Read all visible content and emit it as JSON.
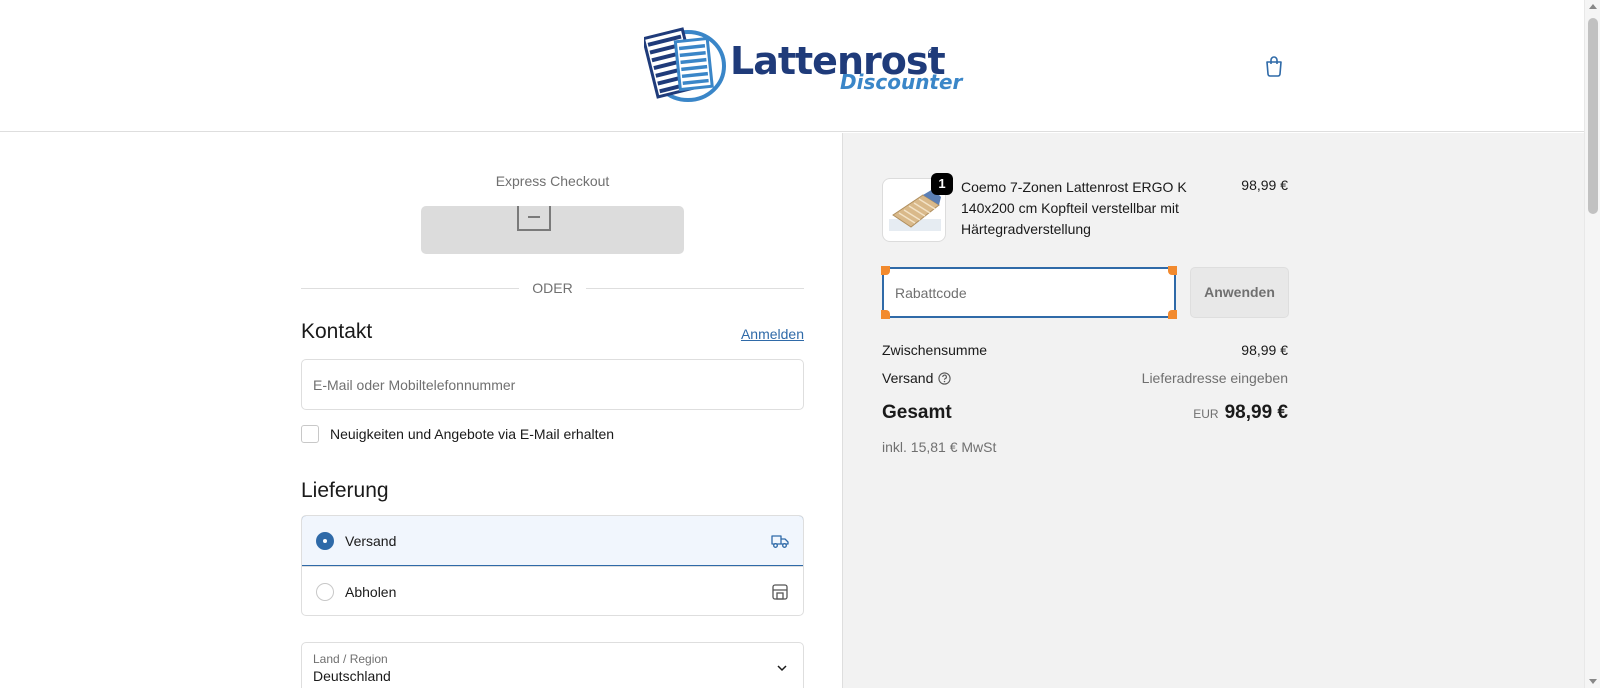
{
  "header": {
    "logo_text": "Lattenrost",
    "logo_sub": "Discounter",
    "logo_reg": "®"
  },
  "express": {
    "title": "Express Checkout",
    "divider": "ODER"
  },
  "contact": {
    "heading": "Kontakt",
    "login_link": "Anmelden",
    "email_placeholder": "E-Mail oder Mobiltelefonnummer",
    "newsletter_label": "Neuigkeiten und Angebote via E-Mail erhalten"
  },
  "delivery": {
    "heading": "Lieferung",
    "options": [
      {
        "label": "Versand",
        "selected": true,
        "icon": "truck-icon"
      },
      {
        "label": "Abholen",
        "selected": false,
        "icon": "store-icon"
      }
    ],
    "country": {
      "label": "Land / Region",
      "value": "Deutschland"
    }
  },
  "summary": {
    "item": {
      "name": "Coemo 7-Zonen Lattenrost ERGO K 140x200 cm Kopfteil verstellbar mit Härtegradverstellung",
      "price": "98,99 €",
      "quantity": "1"
    },
    "discount_placeholder": "Rabattcode",
    "apply_label": "Anwenden",
    "subtotal_label": "Zwischensumme",
    "subtotal_value": "98,99 €",
    "shipping_label": "Versand",
    "shipping_value": "Lieferadresse eingeben",
    "total_label": "Gesamt",
    "total_currency": "EUR",
    "total_value": "98,99 €",
    "tax_note": "inkl. 15,81 € MwSt"
  },
  "colors": {
    "accent": "#2f6aa8",
    "focus_corner": "#f28a2e",
    "summary_bg": "#f2f2f2"
  }
}
